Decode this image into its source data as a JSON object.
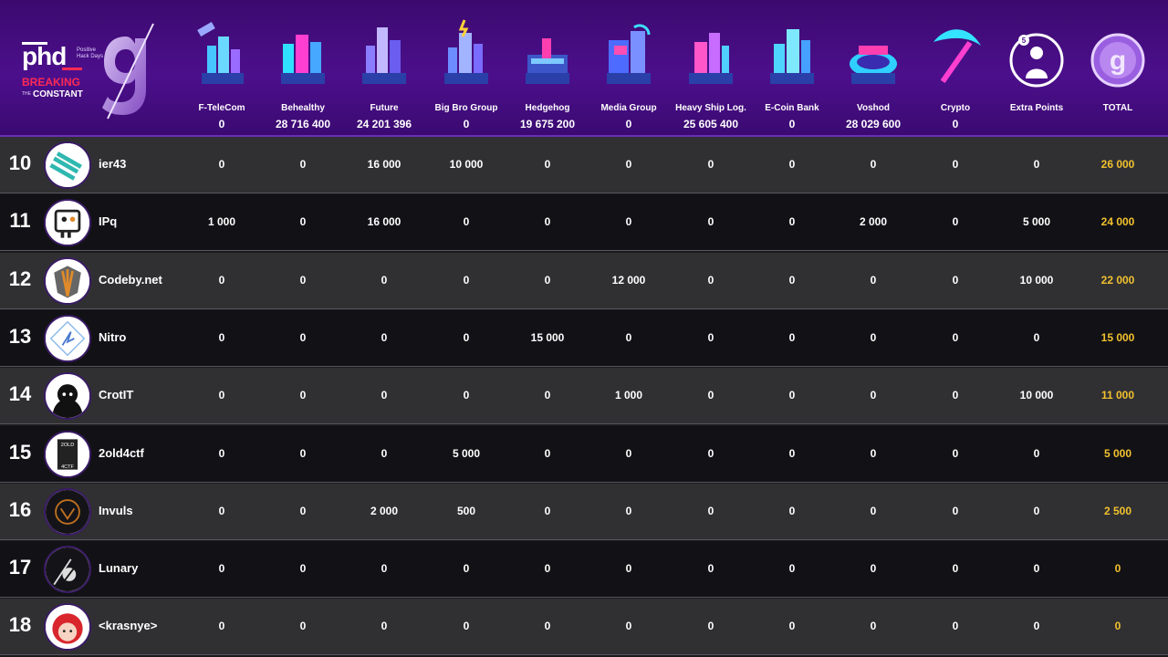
{
  "colors": {
    "header": "#4c0f8c",
    "total": "#f2c12e",
    "row_light": "#303033",
    "row_dark": "#121216"
  },
  "logo": {
    "brand": "phd",
    "tagline": "Positive Hack Days",
    "line1": "BREAKING",
    "line2_small": "THE",
    "line2": "CONSTANT"
  },
  "columns": [
    {
      "name": "F-TeleCom",
      "value": "0",
      "icon": "telecom-city-icon"
    },
    {
      "name": "Behealthy",
      "value": "28 716 400",
      "icon": "health-city-icon"
    },
    {
      "name": "Future",
      "value": "24 201 396",
      "icon": "future-city-icon"
    },
    {
      "name": "Big Bro Group",
      "value": "0",
      "icon": "bigbro-city-icon"
    },
    {
      "name": "Hedgehog",
      "value": "19 675 200",
      "icon": "hedgehog-city-icon"
    },
    {
      "name": "Media Group",
      "value": "0",
      "icon": "media-city-icon"
    },
    {
      "name": "Heavy Ship Log.",
      "value": "25 605 400",
      "icon": "ship-city-icon"
    },
    {
      "name": "E-Coin Bank",
      "value": "0",
      "icon": "bank-city-icon"
    },
    {
      "name": "Voshod",
      "value": "28 029 600",
      "icon": "stadium-city-icon"
    },
    {
      "name": "Crypto",
      "value": "0",
      "icon": "pickaxe-icon"
    },
    {
      "name": "Extra Points",
      "value": "",
      "icon": "extra-points-icon"
    },
    {
      "name": "TOTAL",
      "value": "",
      "icon": "total-logo-icon"
    }
  ],
  "rows": [
    {
      "rank": "10",
      "team": "ier43",
      "scores": [
        "0",
        "0",
        "16 000",
        "10 000",
        "0",
        "0",
        "0",
        "0",
        "0",
        "0",
        "0"
      ],
      "total": "26 000"
    },
    {
      "rank": "11",
      "team": "IPq",
      "scores": [
        "1 000",
        "0",
        "16 000",
        "0",
        "0",
        "0",
        "0",
        "0",
        "2 000",
        "0",
        "5 000"
      ],
      "total": "24 000"
    },
    {
      "rank": "12",
      "team": "Codeby.net",
      "scores": [
        "0",
        "0",
        "0",
        "0",
        "0",
        "12 000",
        "0",
        "0",
        "0",
        "0",
        "10 000"
      ],
      "total": "22 000"
    },
    {
      "rank": "13",
      "team": "Nitro",
      "scores": [
        "0",
        "0",
        "0",
        "0",
        "15 000",
        "0",
        "0",
        "0",
        "0",
        "0",
        "0"
      ],
      "total": "15 000"
    },
    {
      "rank": "14",
      "team": "CrotIT",
      "scores": [
        "0",
        "0",
        "0",
        "0",
        "0",
        "1 000",
        "0",
        "0",
        "0",
        "0",
        "10 000"
      ],
      "total": "11 000"
    },
    {
      "rank": "15",
      "team": "2old4ctf",
      "scores": [
        "0",
        "0",
        "0",
        "5 000",
        "0",
        "0",
        "0",
        "0",
        "0",
        "0",
        "0"
      ],
      "total": "5 000"
    },
    {
      "rank": "16",
      "team": "Invuls",
      "scores": [
        "0",
        "0",
        "2 000",
        "500",
        "0",
        "0",
        "0",
        "0",
        "0",
        "0",
        "0"
      ],
      "total": "2 500"
    },
    {
      "rank": "17",
      "team": "Lunary",
      "scores": [
        "0",
        "0",
        "0",
        "0",
        "0",
        "0",
        "0",
        "0",
        "0",
        "0",
        "0"
      ],
      "total": "0"
    },
    {
      "rank": "18",
      "team": "<krasnye>",
      "scores": [
        "0",
        "0",
        "0",
        "0",
        "0",
        "0",
        "0",
        "0",
        "0",
        "0",
        "0"
      ],
      "total": "0"
    }
  ]
}
